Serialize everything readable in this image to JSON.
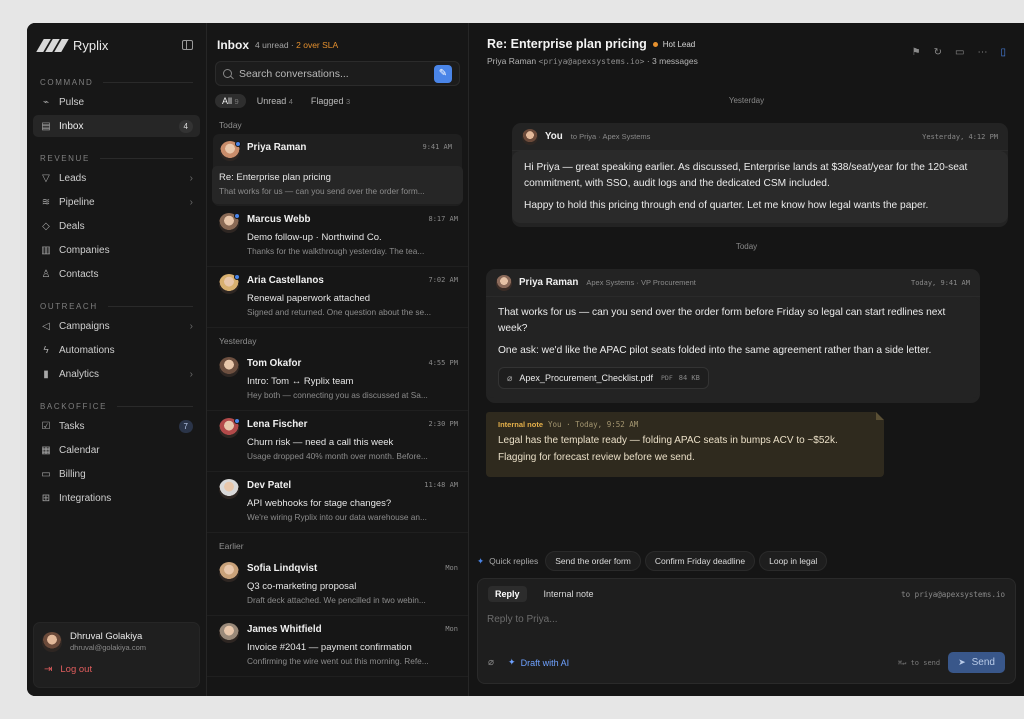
{
  "brand": {
    "name": "Ryplix"
  },
  "sidebar": {
    "sections": [
      {
        "label": "COMMAND",
        "items": [
          {
            "label": "Pulse",
            "icon": "pulse-icon",
            "glyph": "⌁"
          },
          {
            "label": "Inbox",
            "icon": "inbox-icon",
            "glyph": "▤",
            "badge": "4",
            "active": true
          }
        ]
      },
      {
        "label": "REVENUE",
        "items": [
          {
            "label": "Leads",
            "icon": "funnel-icon",
            "glyph": "▽",
            "chevron": true
          },
          {
            "label": "Pipeline",
            "icon": "pipeline-icon",
            "glyph": "≋",
            "chevron": true
          },
          {
            "label": "Deals",
            "icon": "diamond-icon",
            "glyph": "◇"
          },
          {
            "label": "Companies",
            "icon": "building-icon",
            "glyph": "▥"
          },
          {
            "label": "Contacts",
            "icon": "person-icon",
            "glyph": "♙"
          }
        ]
      },
      {
        "label": "OUTREACH",
        "items": [
          {
            "label": "Campaigns",
            "icon": "megaphone-icon",
            "glyph": "◁",
            "chevron": true
          },
          {
            "label": "Automations",
            "icon": "bolt-icon",
            "glyph": "ϟ"
          },
          {
            "label": "Analytics",
            "icon": "bar-chart-icon",
            "glyph": "▮",
            "chevron": true
          }
        ]
      },
      {
        "label": "BACKOFFICE",
        "items": [
          {
            "label": "Tasks",
            "icon": "checkbox-icon",
            "glyph": "☑",
            "badge": "7",
            "badgeBlue": true
          },
          {
            "label": "Calendar",
            "icon": "calendar-icon",
            "glyph": "▦"
          },
          {
            "label": "Billing",
            "icon": "credit-card-icon",
            "glyph": "▭"
          },
          {
            "label": "Integrations",
            "icon": "grid-icon",
            "glyph": "⊞"
          }
        ]
      }
    ],
    "user": {
      "name": "Dhruval Golakiya",
      "email": "dhruval@golakiya.com"
    },
    "logout_label": "Log out"
  },
  "inbox": {
    "title": "Inbox",
    "unread": "4 unread",
    "separator": " · ",
    "sla": "2 over SLA",
    "search_placeholder": "Search conversations...",
    "filters": [
      {
        "label": "All",
        "count": "9",
        "active": true
      },
      {
        "label": "Unread",
        "count": "4"
      },
      {
        "label": "Flagged",
        "count": "3"
      }
    ],
    "groups": [
      {
        "label": "Today",
        "items": [
          {
            "name": "Priya Raman",
            "time": "9:41 AM",
            "subject": "Re: Enterprise plan pricing",
            "preview": "That works for us — can you send over the order form...",
            "unread": true,
            "active": true,
            "hue": "#c98d6b"
          },
          {
            "name": "Marcus Webb",
            "time": "8:17 AM",
            "subject": "Demo follow-up · Northwind Co.",
            "preview": "Thanks for the walkthrough yesterday. The tea...",
            "unread": true,
            "hue": "#8a6a55"
          },
          {
            "name": "Aria Castellanos",
            "time": "7:02 AM",
            "subject": "Renewal paperwork attached",
            "preview": "Signed and returned. One question about the se...",
            "unread": true,
            "hue": "#d8b070"
          }
        ]
      },
      {
        "label": "Yesterday",
        "items": [
          {
            "name": "Tom Okafor",
            "time": "4:55 PM",
            "subject": "Intro: Tom ↔ Ryplix team",
            "preview": "Hey both — connecting you as discussed at Sa...",
            "hue": "#6e5040"
          },
          {
            "name": "Lena Fischer",
            "time": "2:30 PM",
            "subject": "Churn risk — need a call this week",
            "preview": "Usage dropped 40% month over month. Before...",
            "unread": true,
            "hue": "#b34a4a"
          },
          {
            "name": "Dev Patel",
            "time": "11:48 AM",
            "subject": "API webhooks for stage changes?",
            "preview": "We're wiring Ryplix into our data warehouse an...",
            "hue": "#d9d9d9"
          }
        ]
      },
      {
        "label": "Earlier",
        "items": [
          {
            "name": "Sofia Lindqvist",
            "time": "Mon",
            "subject": "Q3 co-marketing proposal",
            "preview": "Draft deck attached. We pencilled in two webin...",
            "hue": "#c9a27a"
          },
          {
            "name": "James Whitfield",
            "time": "Mon",
            "subject": "Invoice #2041 — payment confirmation",
            "preview": "Confirming the wire went out this morning. Refe...",
            "hue": "#9a8a7a"
          }
        ]
      }
    ]
  },
  "thread": {
    "title": "Re: Enterprise plan pricing",
    "tag": "Hot Lead",
    "contact": "Priya Raman",
    "email": "<priya@apexsystems.io>",
    "count": " · 3 messages",
    "day1": "Yesterday",
    "day2": "Today",
    "msg1": {
      "from": "You",
      "context": "to Priya · Apex Systems",
      "time": "Yesterday, 4:12 PM",
      "p1": "Hi Priya — great speaking earlier. As discussed, Enterprise lands at $38/seat/year for the 120-seat commitment, with SSO, audit logs and the dedicated CSM included.",
      "p2": "Happy to hold this pricing through end of quarter. Let me know how legal wants the paper."
    },
    "msg2": {
      "from": "Priya Raman",
      "context": "Apex Systems · VP Procurement",
      "time": "Today, 9:41 AM",
      "p1": "That works for us — can you send over the order form before Friday so legal can start redlines next week?",
      "p2": "One ask: we'd like the APAC pilot seats folded into the same agreement rather than a side letter.",
      "attachment": {
        "name": "Apex_Procurement_Checklist.pdf",
        "type": "PDF",
        "size": "84 KB"
      }
    },
    "note": {
      "label": "Internal note",
      "meta": "You · Today, 9:52 AM",
      "text1": "Legal has the template ready — folding APAC seats in bumps ACV to ~$52k.",
      "text2": "Flagging for forecast review before we send."
    },
    "quick": {
      "label": "Quick replies",
      "chips": [
        "Send the order form",
        "Confirm Friday deadline",
        "Loop in legal"
      ]
    },
    "composer": {
      "tab_reply": "Reply",
      "tab_note": "Internal note",
      "to": "to priya@apexsystems.io",
      "placeholder": "Reply to Priya...",
      "ai": "Draft with AI",
      "hint": "⌘↵ to send",
      "send": "Send"
    }
  },
  "colors": {
    "accent": "#4a85e8",
    "sla": "#e5902e",
    "danger": "#e05d5d",
    "note_bg": "#2f2a1e"
  }
}
